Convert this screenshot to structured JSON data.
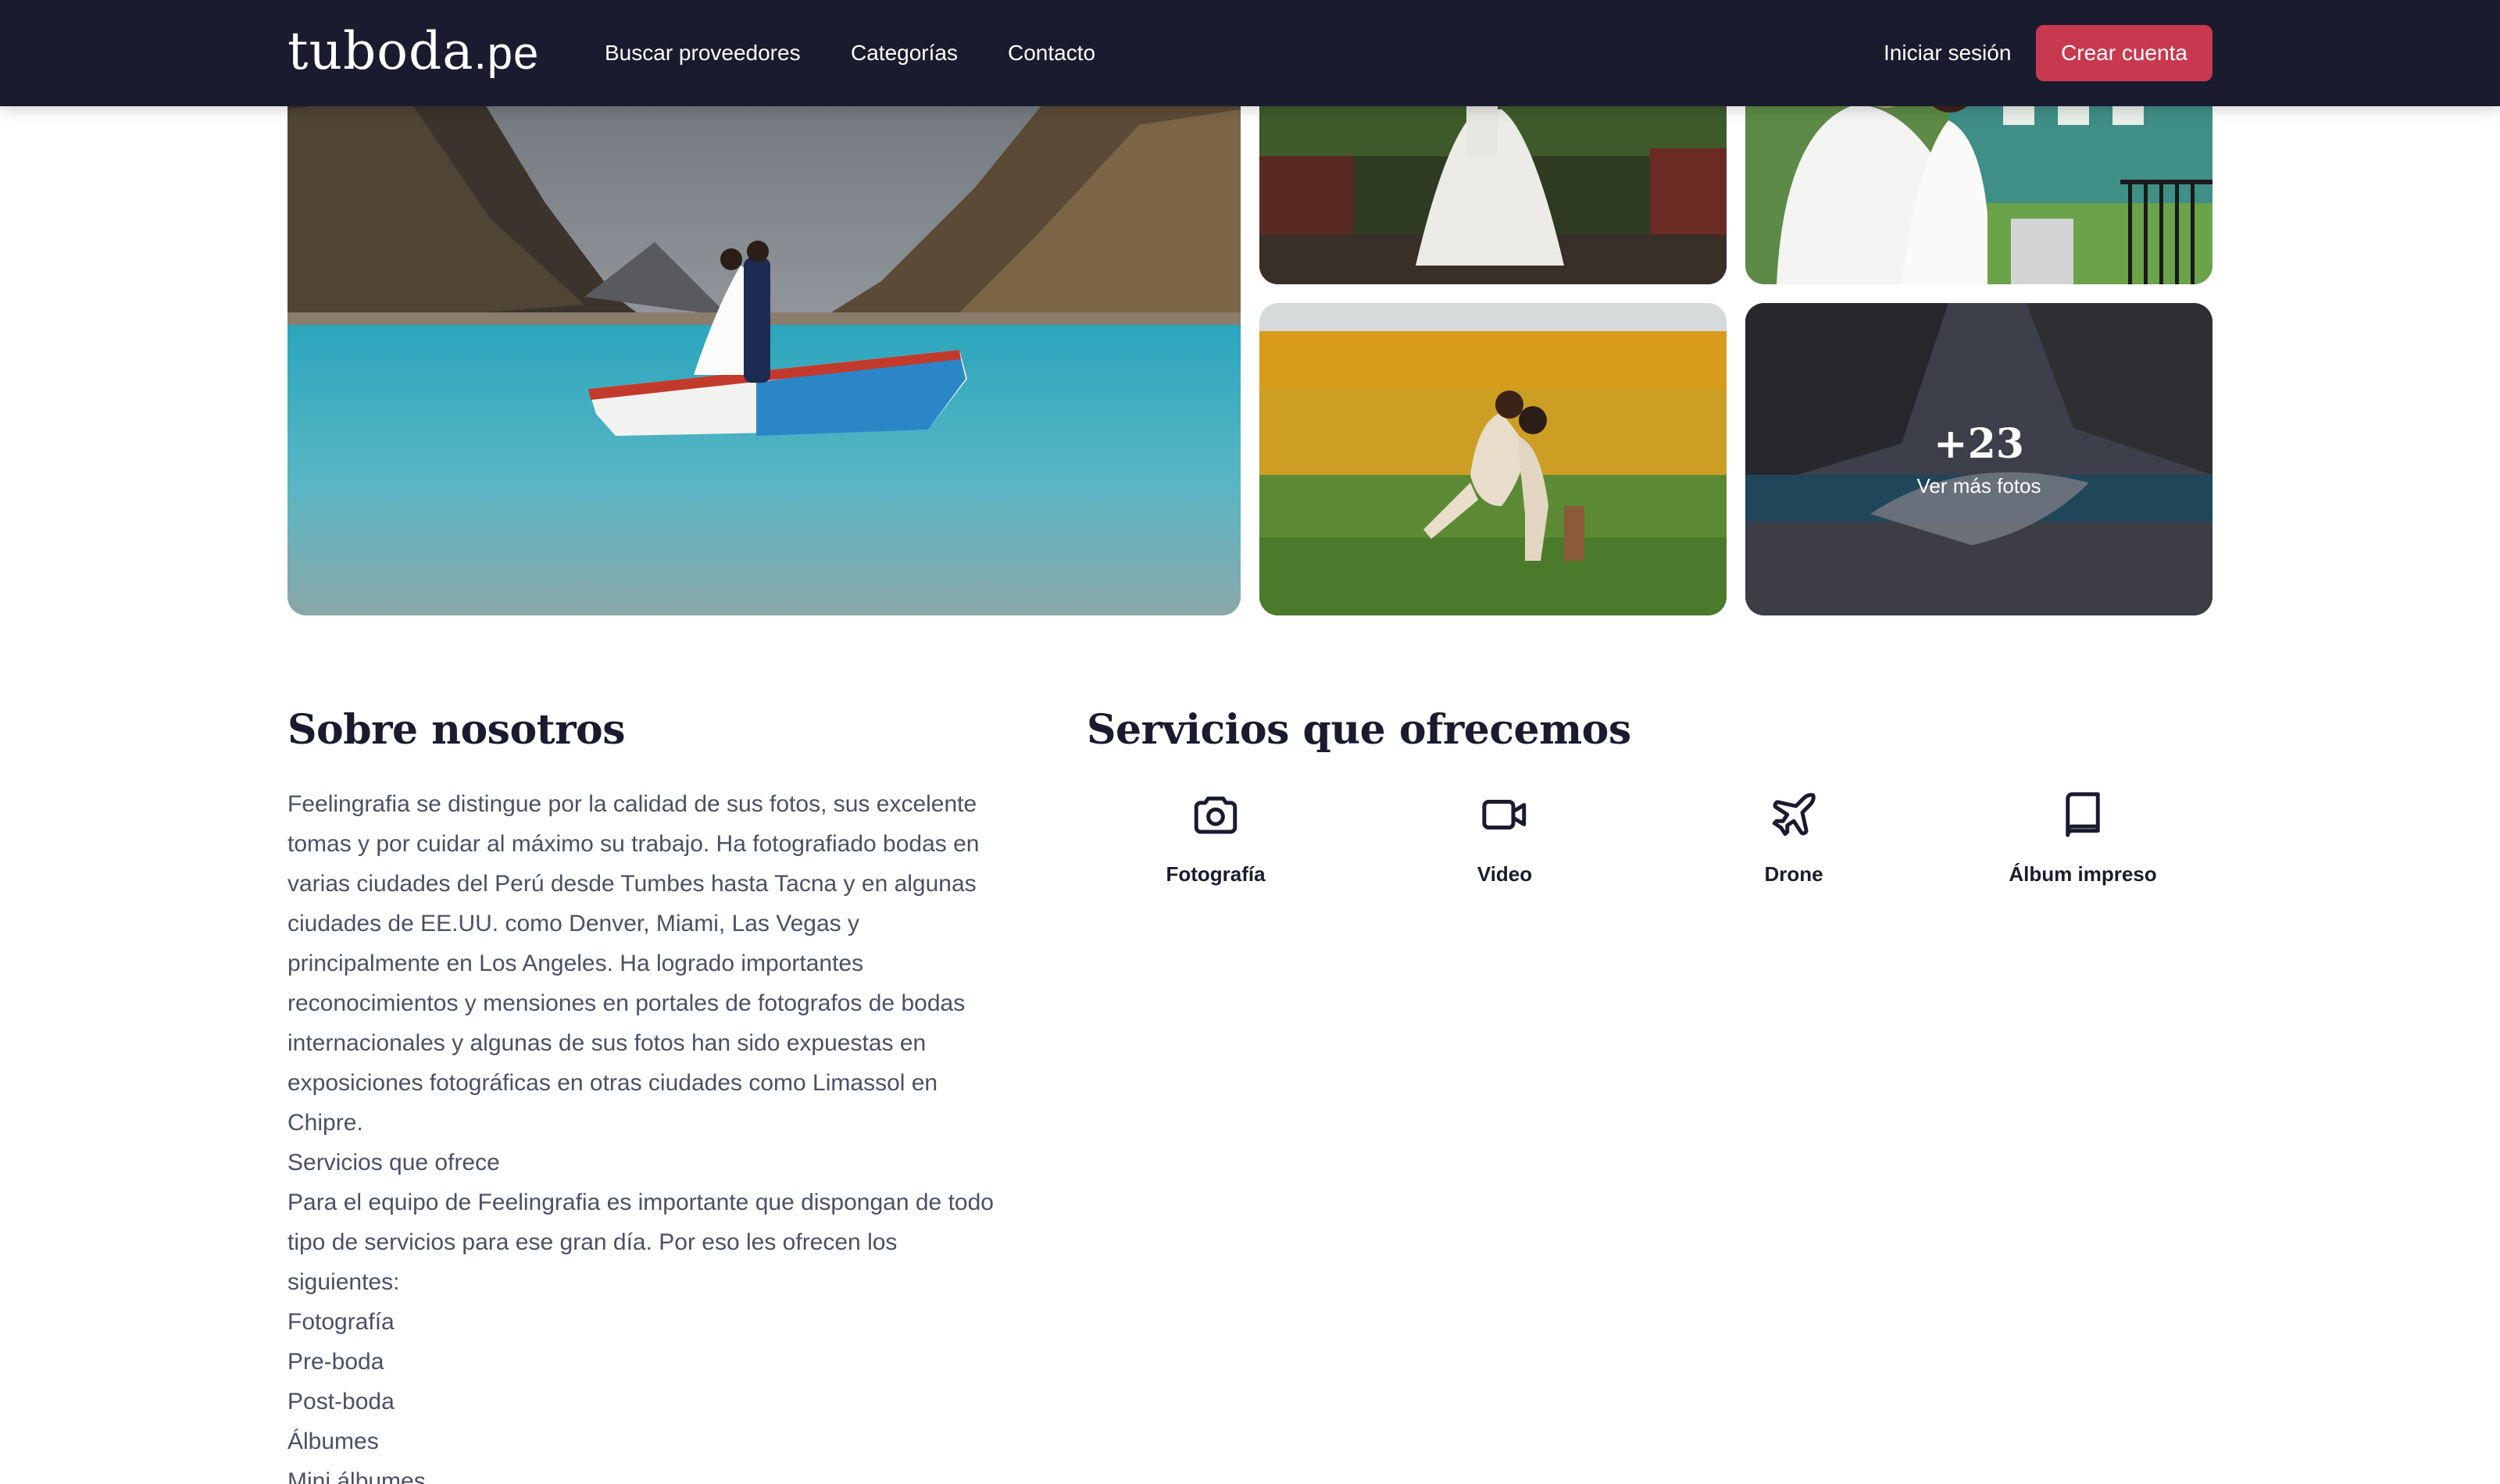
{
  "nav": {
    "logo_main": "tuboda",
    "logo_tld": ".pe",
    "links": [
      "Buscar proveedores",
      "Categorías",
      "Contacto"
    ],
    "login": "Iniciar sesión",
    "signup": "Crear cuenta"
  },
  "gallery": {
    "more_count": "+23",
    "more_label": "Ver más fotos"
  },
  "about": {
    "title": "Sobre nosotros",
    "paragraphs": [
      "Feelingrafia se distingue por la calidad de sus fotos, sus excelente tomas y por cuidar al máximo su trabajo. Ha fotografiado bodas en varias ciudades del Perú desde Tumbes hasta Tacna y en algunas ciudades de EE.UU. como Denver, Miami, Las Vegas y principalmente en Los Angeles. Ha logrado importantes reconocimientos y mensiones en portales de fotografos de bodas internacionales y algunas de sus fotos han sido expuestas en exposiciones fotográficas en otras ciudades como Limassol en Chipre.",
      "Servicios que ofrece",
      "Para el equipo de Feelingrafia es importante que dispongan de todo tipo de servicios para ese gran día. Por eso les ofrecen los siguientes:",
      "Fotografía",
      "Pre-boda",
      "Post-boda",
      "Álbumes",
      "Mini álbumes"
    ]
  },
  "services": {
    "title": "Servicios que ofrecemos",
    "items": [
      {
        "label": "Fotografía",
        "icon": "camera-icon"
      },
      {
        "label": "Video",
        "icon": "video-camera-icon"
      },
      {
        "label": "Drone",
        "icon": "plane-icon"
      },
      {
        "label": "Álbum impreso",
        "icon": "book-icon"
      }
    ]
  },
  "colors": {
    "nav_bg": "#1b1b2f",
    "accent": "#c8394f",
    "body_text": "#4b5063",
    "heading": "#1b1b2f"
  }
}
